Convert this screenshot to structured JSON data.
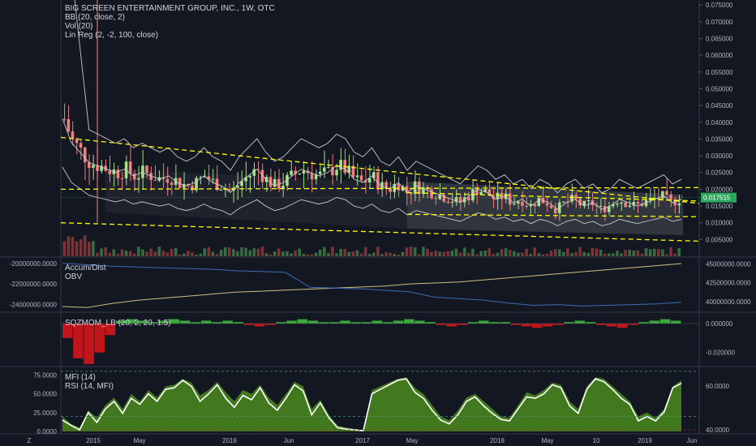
{
  "chart_data": {
    "type": "candlestick",
    "title": "BIG SCREEN ENTERTAINMENT GROUP, INC., 1W, OTC",
    "price_axis": {
      "ticks": [
        "0.075000",
        "0.070000",
        "0.065000",
        "0.060000",
        "0.055000",
        "0.050000",
        "0.045000",
        "0.040000",
        "0.035000",
        "0.030000",
        "0.025000",
        "0.020000",
        "0.015000",
        "0.010000",
        "0.005000"
      ],
      "range": [
        0.0,
        0.0765
      ],
      "last_price_label": "0.017515",
      "last_price": 0.017515
    },
    "time_axis": {
      "ticks": [
        "Z",
        "2015",
        "May",
        "2016",
        "Jun",
        "2017",
        "May",
        "2018",
        "May",
        "10",
        "2019",
        "Jun"
      ]
    },
    "price_legend": [
      "BIG SCREEN ENTERTAINMENT GROUP, INC., 1W, OTC",
      "BB (20, close, 2)",
      "Vol (20)",
      "Lin Reg (2, -2, 100, close)"
    ],
    "price_path": [
      0.041,
      0.034,
      0.031,
      0.028,
      0.027,
      0.026,
      0.025,
      0.026,
      0.024,
      0.025,
      0.024,
      0.023,
      0.024,
      0.022,
      0.021,
      0.022,
      0.024,
      0.022,
      0.021,
      0.019,
      0.022,
      0.024,
      0.026,
      0.023,
      0.021,
      0.022,
      0.024,
      0.026,
      0.025,
      0.024,
      0.025,
      0.027,
      0.026,
      0.023,
      0.022,
      0.024,
      0.021,
      0.02,
      0.022,
      0.019,
      0.021,
      0.02,
      0.019,
      0.018,
      0.017,
      0.016,
      0.018,
      0.02,
      0.019,
      0.017,
      0.018,
      0.016,
      0.017,
      0.015,
      0.017,
      0.016,
      0.014,
      0.016,
      0.017,
      0.015,
      0.016,
      0.014,
      0.015,
      0.017,
      0.016,
      0.015,
      0.016,
      0.017,
      0.018,
      0.016,
      0.017
    ],
    "accum_dist_axis": {
      "ticks": [
        "-20000000.0000",
        "-22000000.0000",
        "-24000000.0000"
      ]
    },
    "obv_axis": {
      "ticks": [
        "45000000.0000",
        "42500000.0000",
        "40000000.0000"
      ]
    },
    "accum_legend": [
      "Accum/Dist",
      "OBV"
    ],
    "accum_dist": [
      -24.2,
      -24.3,
      -23.9,
      -23.6,
      -23.4,
      -23.2,
      -23.0,
      -22.8,
      -22.7,
      -22.6,
      -22.5,
      -22.4,
      -22.3,
      -22.2,
      -22.0,
      -21.9,
      -21.8,
      -21.6,
      -21.4,
      -21.2,
      -21.0,
      -20.8,
      -20.6,
      -20.4,
      -20.2,
      -20.0
    ],
    "obv": [
      45.1,
      44.9,
      44.7,
      44.6,
      44.5,
      44.4,
      44.3,
      44.1,
      44.0,
      43.9,
      41.9,
      41.8,
      41.7,
      41.5,
      41.3,
      40.6,
      40.4,
      40.2,
      39.8,
      39.5,
      39.6,
      39.4,
      39.5,
      39.6,
      39.7,
      39.9
    ],
    "sqzmom_axis": {
      "ticks": [
        "0.000000",
        "-0.020000"
      ]
    },
    "sqzmom_legend": "SQZMOM_LB (20, 2, 20, 1.5)",
    "sqzmom": [
      -0.01,
      -0.024,
      -0.028,
      -0.02,
      -0.008,
      0.002,
      0.003,
      0.002,
      0.001,
      0.002,
      0.003,
      0.002,
      0.001,
      0.002,
      0.001,
      0.002,
      0.001,
      -0.001,
      -0.002,
      -0.001,
      0.001,
      0.002,
      0.003,
      0.002,
      0.001,
      0.001,
      0.002,
      0.001,
      0.001,
      0.002,
      0.001,
      0.002,
      0.003,
      0.002,
      0.001,
      -0.001,
      -0.002,
      -0.001,
      0.001,
      0.002,
      0.001,
      0.001,
      -0.001,
      -0.002,
      -0.003,
      -0.002,
      -0.001,
      0.001,
      0.002,
      0.001,
      -0.001,
      -0.002,
      -0.003,
      -0.001,
      0.001,
      0.002,
      0.003,
      0.002
    ],
    "mfi_left_axis": {
      "ticks": [
        "75.0000",
        "50.0000",
        "25.0000",
        "0.0000"
      ]
    },
    "rsi_right_axis": {
      "ticks": [
        "60.0000",
        "40.0000"
      ]
    },
    "mfi_legend": [
      "MFI (14)",
      "RSI (14, MFI)"
    ],
    "mfi": [
      20,
      10,
      5,
      28,
      18,
      35,
      45,
      30,
      50,
      40,
      55,
      45,
      60,
      62,
      70,
      65,
      48,
      55,
      66,
      52,
      40,
      55,
      50,
      62,
      45,
      35,
      50,
      66,
      60,
      30,
      42,
      22,
      8,
      5,
      3,
      2,
      55,
      60,
      65,
      70,
      72,
      58,
      50,
      35,
      20,
      15,
      28,
      45,
      50,
      40,
      30,
      20,
      18,
      35,
      52,
      48,
      55,
      65,
      62,
      40,
      30,
      60,
      72,
      70,
      60,
      50,
      40,
      20,
      25,
      18,
      30,
      60,
      68
    ],
    "rsi": [
      15,
      8,
      2,
      25,
      12,
      30,
      40,
      24,
      44,
      36,
      50,
      40,
      56,
      58,
      68,
      60,
      40,
      50,
      62,
      44,
      32,
      48,
      42,
      58,
      38,
      28,
      44,
      62,
      54,
      22,
      38,
      18,
      5,
      3,
      2,
      1,
      50,
      56,
      62,
      68,
      70,
      52,
      44,
      28,
      15,
      10,
      22,
      40,
      46,
      34,
      24,
      16,
      14,
      30,
      46,
      44,
      50,
      62,
      58,
      34,
      24,
      56,
      70,
      66,
      56,
      44,
      36,
      14,
      20,
      14,
      26,
      58,
      64
    ],
    "colors": {
      "background": "#131722",
      "up": "#a5e08d",
      "down": "#f08080",
      "bb": "#c8c8c8",
      "linreg": "#ffff00",
      "accum": "#cfc07f",
      "obv": "#3b6db5",
      "mfi_fill": "#4b8b1e",
      "rsi": "#ffffff",
      "sqz_neg": "#c0151b",
      "sqz_pos": "#3aa83a",
      "last_price": "#2aa85b"
    }
  }
}
